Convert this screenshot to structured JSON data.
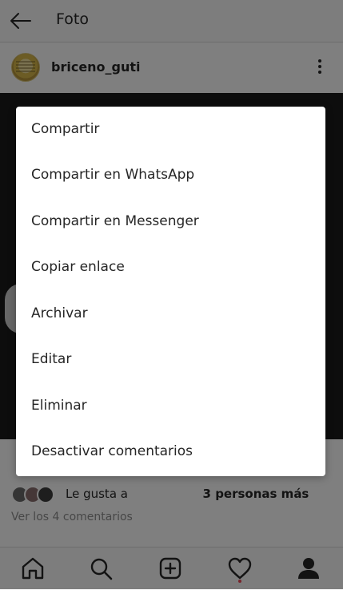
{
  "header": {
    "title": "Foto"
  },
  "post": {
    "username": "briceno_guti"
  },
  "likes": {
    "prefix": "Le gusta a",
    "suffix": "3 personas más"
  },
  "comments": {
    "view_all": "Ver los 4 comentarios"
  },
  "menu": {
    "items": [
      "Compartir",
      "Compartir en WhatsApp",
      "Compartir en Messenger",
      "Copiar enlace",
      "Archivar",
      "Editar",
      "Eliminar",
      "Desactivar comentarios"
    ]
  },
  "icons": {
    "back": "arrow-left-icon",
    "options": "more-vertical-icon",
    "home": "home-icon",
    "search": "search-icon",
    "new_post": "add-post-icon",
    "activity": "heart-icon",
    "profile": "profile-icon"
  },
  "colors": {
    "overlay": "rgba(0,0,0,0.5)",
    "notification_dot": "#ed4956",
    "text": "#262626",
    "muted": "#8e8e8e"
  }
}
